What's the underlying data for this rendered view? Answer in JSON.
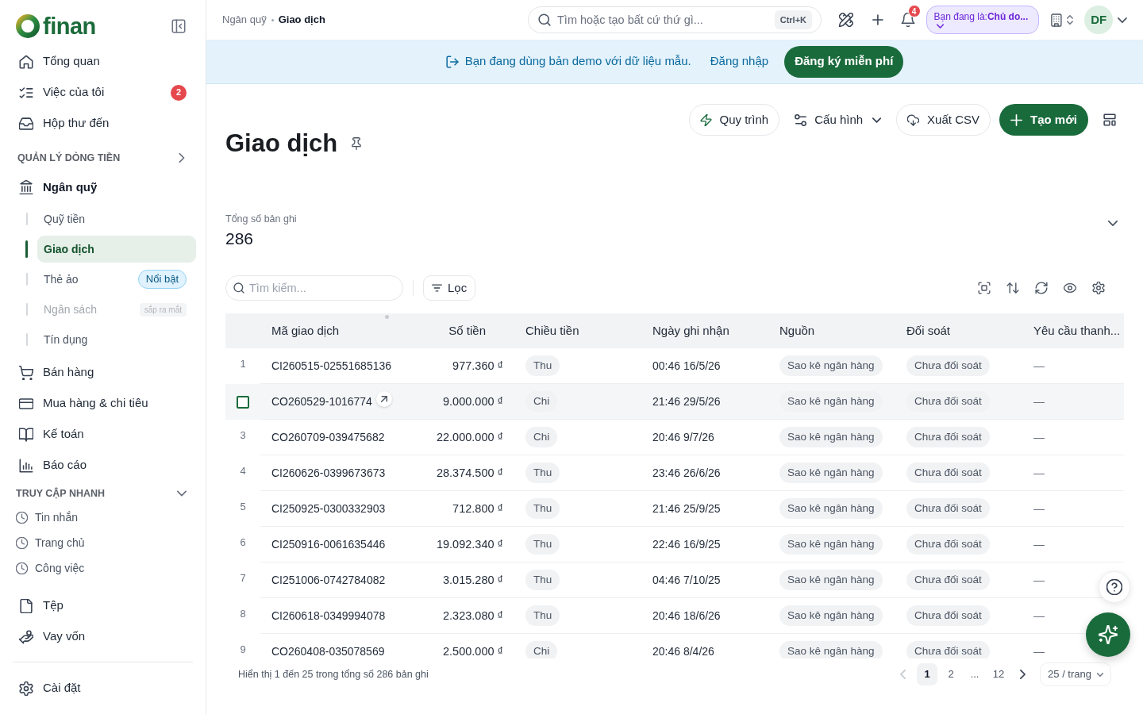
{
  "sidebar": {
    "brand": "finan",
    "nav": [
      {
        "kind": "item",
        "label": "Tổng quan"
      },
      {
        "kind": "item",
        "label": "Việc của tôi",
        "badge": "2"
      },
      {
        "kind": "item",
        "label": "Hộp thư đến"
      },
      {
        "kind": "section",
        "label": "QUẢN LÝ DÒNG TIỀN"
      },
      {
        "kind": "group",
        "label": "Ngân quỹ",
        "children": [
          {
            "label": "Quỹ tiền",
            "selected": false,
            "disabled": false
          },
          {
            "label": "Giao dịch",
            "selected": true,
            "disabled": false
          },
          {
            "label": "Thẻ ảo",
            "selected": false,
            "disabled": false,
            "tag": {
              "kind": "highlight",
              "text": "Nổi bật"
            }
          },
          {
            "label": "Ngân sách",
            "selected": false,
            "disabled": true,
            "tag": {
              "kind": "soon",
              "text": "sắp ra mắt"
            }
          },
          {
            "label": "Tín dụng",
            "selected": false,
            "disabled": false
          }
        ]
      },
      {
        "kind": "item",
        "label": "Bán hàng"
      },
      {
        "kind": "item",
        "label": "Mua hàng & chi tiêu"
      },
      {
        "kind": "item",
        "label": "Kế toán"
      },
      {
        "kind": "item",
        "label": "Báo cáo"
      },
      {
        "kind": "section",
        "label": "TRUY CẬP NHANH"
      },
      {
        "kind": "recent",
        "label": "Tin nhắn"
      },
      {
        "kind": "recent",
        "label": "Trang chủ"
      },
      {
        "kind": "recent",
        "label": "Công việc"
      },
      {
        "kind": "item",
        "label": "Tệp"
      },
      {
        "kind": "item",
        "label": "Vay vốn"
      }
    ],
    "settings": "Cài đặt"
  },
  "topbar": {
    "breadcrumb": [
      "Ngân quỹ",
      "Giao dịch"
    ],
    "search": {
      "placeholder": "Tìm hoặc tạo bất cứ thứ gì...",
      "shortcut": "Ctrl+K"
    },
    "notification_count": "4",
    "role": "Bạn đang là:**Chủ do...**",
    "avatar": "DF"
  },
  "banner": {
    "message": "Bạn đang dùng bản demo với dữ liệu mẫu.",
    "login": "Đăng nhập",
    "signup": "Đăng ký miễn phí"
  },
  "page": {
    "title": "Giao dịch",
    "actions": [
      {
        "kind": "outline",
        "label": "Quy trình"
      },
      {
        "kind": "menu",
        "label": "Cấu hình"
      },
      {
        "kind": "outline",
        "label": "Xuất CSV"
      },
      {
        "kind": "primary",
        "label": "Tạo mới"
      }
    ],
    "summary": {
      "label": "Tổng số bản ghi",
      "value": "286"
    }
  },
  "toolbar": {
    "search": {
      "placeholder": "Tìm kiếm..."
    },
    "filter": "Lọc"
  },
  "table": {
    "columns": [
      "Mã giao dịch",
      "Số tiền",
      "Chiều tiền",
      "Ngày ghi nhận",
      "Nguồn",
      "Đối soát",
      "Yêu cầu thanh..."
    ],
    "rows": [
      {
        "number": "1",
        "hovered": false,
        "checked": false,
        "code": "CI260515-02551685136",
        "amount": "977.360 ₫",
        "direction": "Thu",
        "date": "00:46 16/5/26",
        "source": "Sao kê ngân hàng",
        "reconciliation": "Chưa đối soát",
        "request": "—"
      },
      {
        "hovered": true,
        "checked": false,
        "code": "CO260529-1016774",
        "amount": "9.000.000 ₫",
        "direction": "Chi",
        "date": "21:46 29/5/26",
        "source": "Sao kê ngân hàng",
        "reconciliation": "Chưa đối soát",
        "request": "—"
      },
      {
        "number": "3",
        "hovered": false,
        "checked": false,
        "code": "CO260709-039475682",
        "amount": "22.000.000 ₫",
        "direction": "Chi",
        "date": "20:46 9/7/26",
        "source": "Sao kê ngân hàng",
        "reconciliation": "Chưa đối soát",
        "request": "—"
      },
      {
        "number": "4",
        "hovered": false,
        "checked": false,
        "code": "CI260626-0399673673",
        "amount": "28.374.500 ₫",
        "direction": "Thu",
        "date": "23:46 26/6/26",
        "source": "Sao kê ngân hàng",
        "reconciliation": "Chưa đối soát",
        "request": "—"
      },
      {
        "number": "5",
        "hovered": false,
        "checked": false,
        "code": "CI250925-0300332903",
        "amount": "712.800 ₫",
        "direction": "Thu",
        "date": "21:46 25/9/25",
        "source": "Sao kê ngân hàng",
        "reconciliation": "Chưa đối soát",
        "request": "—"
      },
      {
        "number": "6",
        "hovered": false,
        "checked": false,
        "code": "CI250916-0061635446",
        "amount": "19.092.340 ₫",
        "direction": "Thu",
        "date": "22:46 16/9/25",
        "source": "Sao kê ngân hàng",
        "reconciliation": "Chưa đối soát",
        "request": "—"
      },
      {
        "number": "7",
        "hovered": false,
        "checked": false,
        "code": "CI251006-0742784082",
        "amount": "3.015.280 ₫",
        "direction": "Thu",
        "date": "04:46 7/10/25",
        "source": "Sao kê ngân hàng",
        "reconciliation": "Chưa đối soát",
        "request": "—"
      },
      {
        "number": "8",
        "hovered": false,
        "checked": false,
        "code": "CI260618-0349994078",
        "amount": "2.323.080 ₫",
        "direction": "Thu",
        "date": "20:46 18/6/26",
        "source": "Sao kê ngân hàng",
        "reconciliation": "Chưa đối soát",
        "request": "—"
      },
      {
        "number": "9",
        "hovered": false,
        "checked": false,
        "code": "CO260408-035078569",
        "amount": "2.500.000 ₫",
        "direction": "Chi",
        "date": "20:46 8/4/26",
        "source": "Sao kê ngân hàng",
        "reconciliation": "Chưa đối soát",
        "request": "—"
      }
    ]
  },
  "pagination": {
    "summary": "Hiển thị 1 đến 25 trong tổng số 286 bản ghi",
    "prev": {
      "disabled": true
    },
    "pages": [
      {
        "label": "1",
        "selected": true
      },
      {
        "label": "2",
        "selected": false
      },
      {
        "label": "...",
        "selected": false
      },
      {
        "label": "12",
        "selected": false
      }
    ],
    "next": {
      "disabled": false
    },
    "page_size": "25 / trang"
  }
}
